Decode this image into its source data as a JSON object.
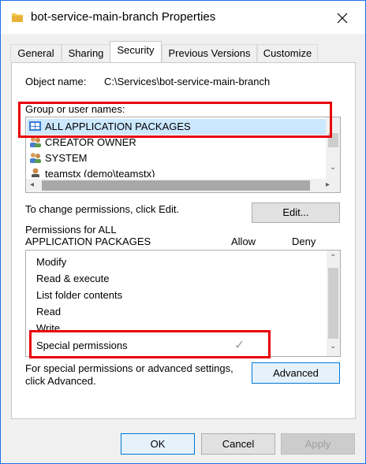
{
  "window": {
    "title": "bot-service-main-branch Properties"
  },
  "tabs": [
    {
      "label": "General"
    },
    {
      "label": "Sharing"
    },
    {
      "label": "Security"
    },
    {
      "label": "Previous Versions"
    },
    {
      "label": "Customize"
    }
  ],
  "security": {
    "object_name_label": "Object name:",
    "object_name_value": "C:\\Services\\bot-service-main-branch",
    "group_label": "Group or user names:",
    "groups": [
      {
        "name": "ALL APPLICATION PACKAGES",
        "icon": "app-packages-icon"
      },
      {
        "name": "CREATOR OWNER",
        "icon": "users-icon"
      },
      {
        "name": "SYSTEM",
        "icon": "users-icon"
      },
      {
        "name": "teamstx (demo\\teamstx)",
        "icon": "user-icon"
      }
    ],
    "change_text": "To change permissions, click Edit.",
    "edit_button": "Edit...",
    "permissions_label_line1": "Permissions for ALL",
    "permissions_label_line2": "APPLICATION PACKAGES",
    "allow_header": "Allow",
    "deny_header": "Deny",
    "permissions": [
      {
        "name": "Modify"
      },
      {
        "name": "Read & execute"
      },
      {
        "name": "List folder contents"
      },
      {
        "name": "Read"
      },
      {
        "name": "Write"
      },
      {
        "name": "Special permissions",
        "allow": "✓"
      }
    ],
    "special_text_line1": "For special permissions or advanced settings,",
    "special_text_line2": "click Advanced.",
    "advanced_button": "Advanced"
  },
  "footer": {
    "ok": "OK",
    "cancel": "Cancel",
    "apply": "Apply"
  },
  "colors": {
    "highlight": "#e8000b",
    "selection": "#cce8ff",
    "accent": "#0078d7"
  }
}
